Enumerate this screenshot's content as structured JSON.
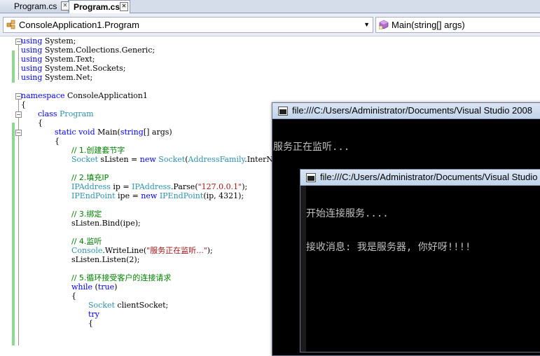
{
  "tabs": [
    {
      "label": "Program.cs",
      "active": false
    },
    {
      "label": "Program.cs",
      "active": true
    }
  ],
  "nav": {
    "class_combo": "ConsoleApplication1.Program",
    "member_combo": "Main(string[] args)"
  },
  "code": {
    "l1": [
      "using",
      " System;"
    ],
    "l2": [
      "using",
      " System.Collections.Generic;"
    ],
    "l3": [
      "using",
      " System.Text;"
    ],
    "l4": [
      "using",
      " System.Net.Sockets;"
    ],
    "l5": [
      "using",
      " System.Net;"
    ],
    "l7": [
      "namespace",
      " ConsoleApplication1"
    ],
    "l8": "{",
    "l9": [
      "class",
      "Program"
    ],
    "l10": "{",
    "l11": [
      "static void",
      " Main(",
      "string",
      "[] args)"
    ],
    "l12": "{",
    "l13": "// 1.创建套节字",
    "l14": [
      "Socket",
      " sListen = ",
      "new",
      "Socket",
      "(",
      "AddressFamily",
      ".InterN"
    ],
    "l16": "// 2.填充IP",
    "l17": [
      "IPAddress",
      " ip = ",
      "IPAddress",
      ".Parse(",
      "\"127.0.0.1\"",
      ");"
    ],
    "l18": [
      "IPEndPoint",
      " ipe = ",
      "new",
      "IPEndPoint",
      "(ip, 4321);"
    ],
    "l20": "// 3.绑定",
    "l21": "sListen.Bind(ipe);",
    "l23": "// 4.监听",
    "l24": [
      "Console",
      ".WriteLine(",
      "\"服务正在监听...\"",
      ");"
    ],
    "l25": "sListen.Listen(2);",
    "l27": "// 5.循环接受客户的连接请求",
    "l28": [
      "while",
      " (",
      "true",
      ")"
    ],
    "l29": "{",
    "l30": [
      "Socket",
      " clientSocket;"
    ],
    "l31": "try",
    "l32": "{"
  },
  "console1": {
    "title": "file:///C:/Users/Administrator/Documents/Visual Studio 2008",
    "lines": [
      "服务正在监听..."
    ]
  },
  "console2": {
    "title": "file:///C:/Users/Administrator/Documents/Visual Studio",
    "lines": [
      "开始连接服务....",
      "接收消息: 我是服务器, 你好呀!!!!"
    ]
  },
  "colors": {
    "keyword": "#0000ff",
    "type": "#2b91af",
    "comment": "#008000",
    "string": "#a31515",
    "changed_margin": "#8fd98f"
  },
  "icons": {
    "class_combo": "class-icon",
    "member_combo": "method-icon",
    "console": "console-icon"
  }
}
